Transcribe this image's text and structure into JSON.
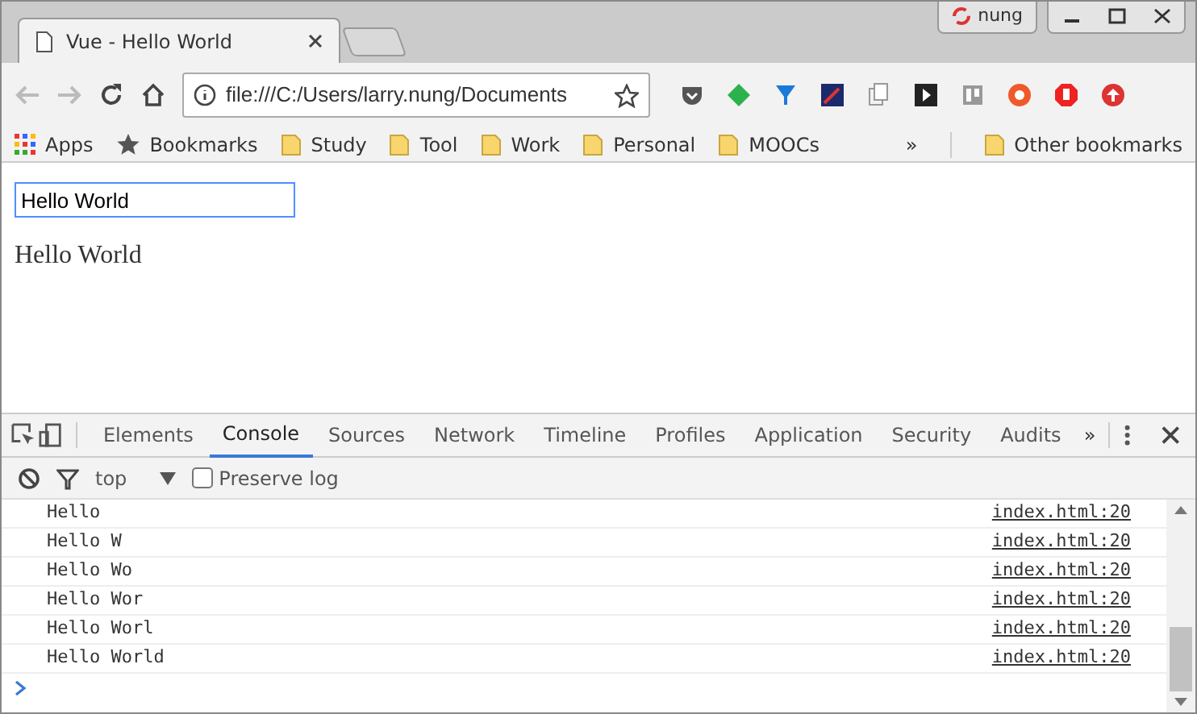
{
  "window": {
    "profile": "nung",
    "tabs": [
      {
        "title": "Vue - Hello World",
        "selected": true
      }
    ]
  },
  "toolbar": {
    "address": "file:///C:/Users/larry.nung/Documents"
  },
  "bookmarks": [
    {
      "label": "Apps",
      "kind": "apps"
    },
    {
      "label": "Bookmarks",
      "kind": "star"
    },
    {
      "label": "Study",
      "kind": "folder"
    },
    {
      "label": "Tool",
      "kind": "folder"
    },
    {
      "label": "Work",
      "kind": "folder"
    },
    {
      "label": "Personal",
      "kind": "folder"
    },
    {
      "label": "MOOCs",
      "kind": "folder"
    }
  ],
  "bookmarks_overflow": "»",
  "other_bookmarks": "Other bookmarks",
  "page": {
    "input_value": "Hello World",
    "text": "Hello World"
  },
  "devtools": {
    "tabs": [
      {
        "label": "Elements",
        "selected": false
      },
      {
        "label": "Console",
        "selected": true
      },
      {
        "label": "Sources",
        "selected": false
      },
      {
        "label": "Network",
        "selected": false
      },
      {
        "label": "Timeline",
        "selected": false
      },
      {
        "label": "Profiles",
        "selected": false
      },
      {
        "label": "Application",
        "selected": false
      },
      {
        "label": "Security",
        "selected": false
      },
      {
        "label": "Audits",
        "selected": false
      }
    ],
    "tabs_overflow": "»",
    "context": "top",
    "preserve_log": {
      "label": "Preserve log",
      "checked": false
    },
    "log": [
      {
        "message": "Hello",
        "source": "index.html:20"
      },
      {
        "message": "Hello W",
        "source": "index.html:20"
      },
      {
        "message": "Hello Wo",
        "source": "index.html:20"
      },
      {
        "message": "Hello Wor",
        "source": "index.html:20"
      },
      {
        "message": "Hello Worl",
        "source": "index.html:20"
      },
      {
        "message": "Hello World",
        "source": "index.html:20"
      }
    ]
  }
}
